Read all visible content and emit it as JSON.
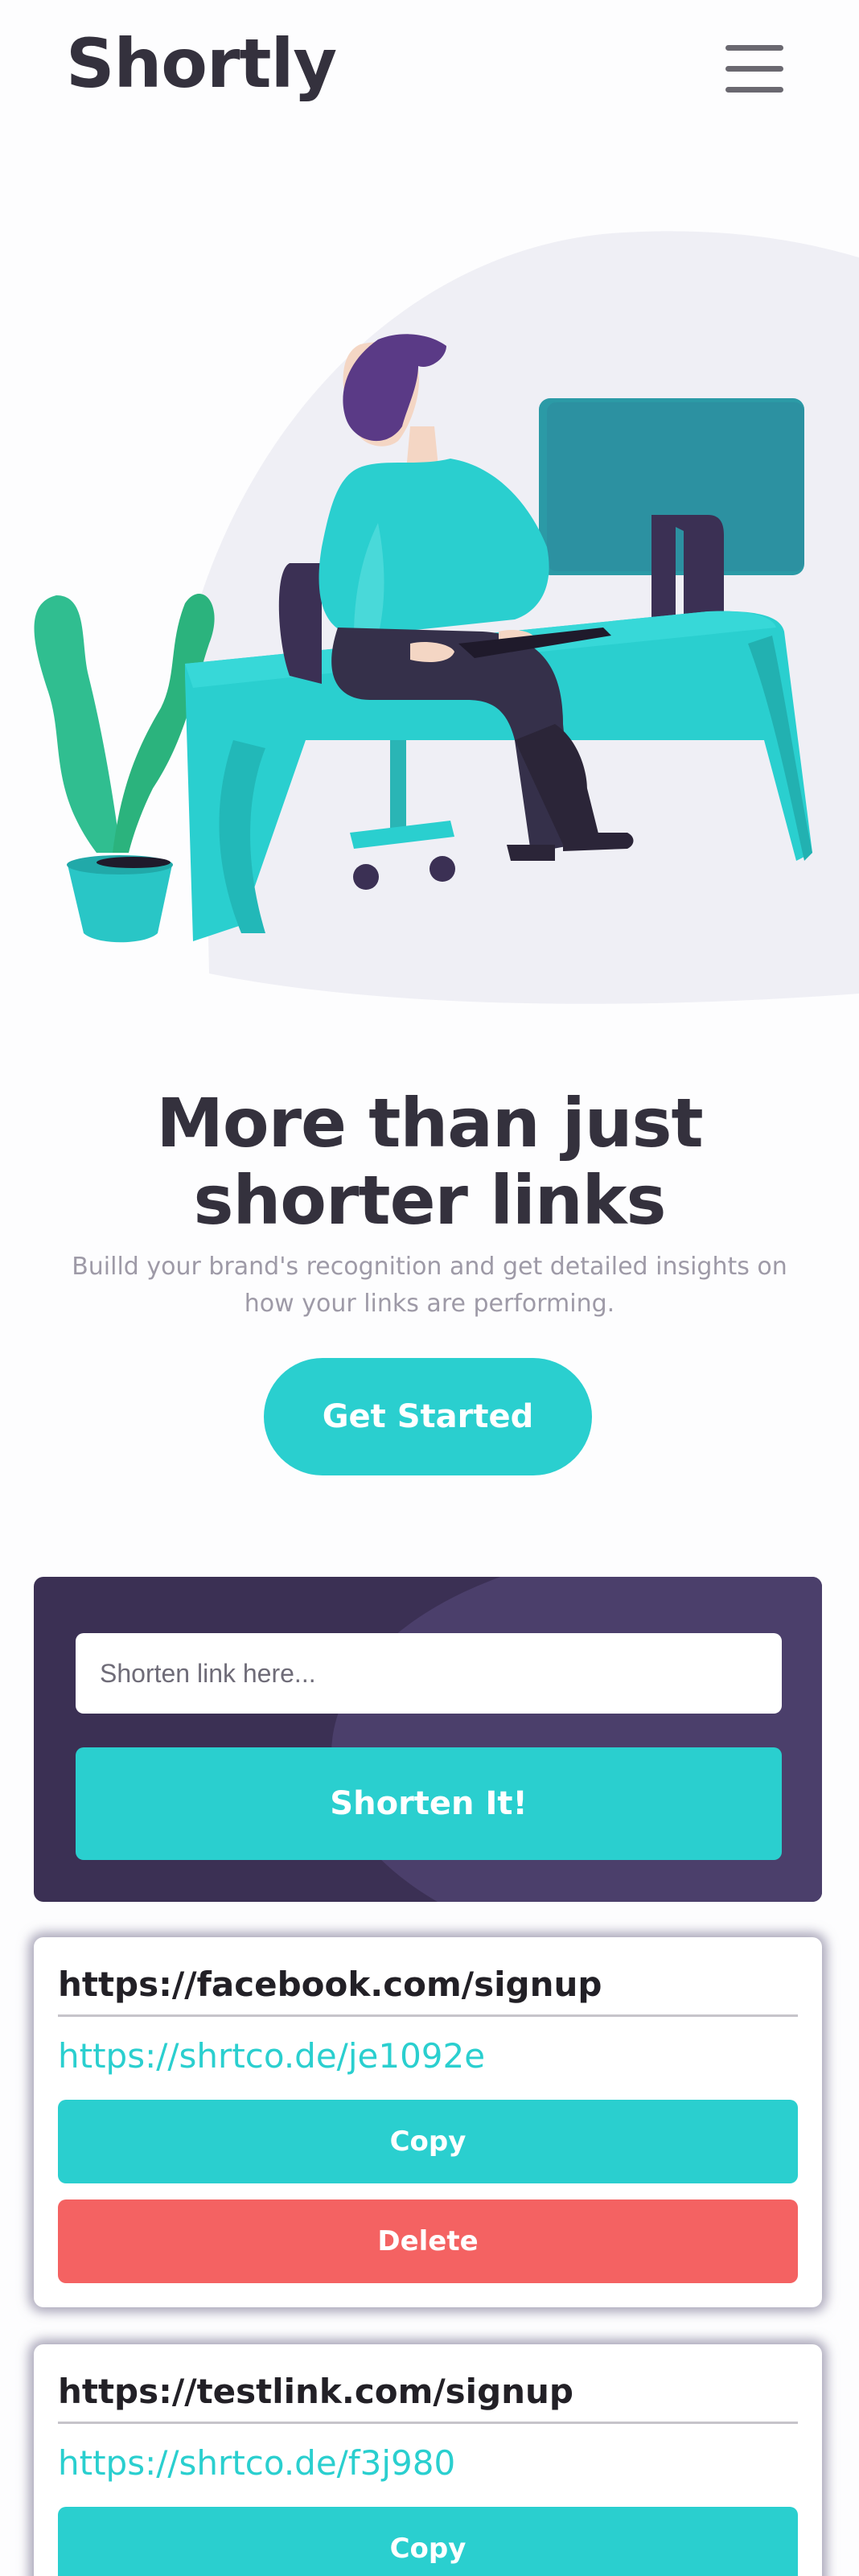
{
  "header": {
    "logo": "Shortly",
    "menu_icon": "hamburger-menu-icon"
  },
  "hero": {
    "illustration": "person-working-at-desk-illustration",
    "title": "More than just shorter links",
    "subtitle": "Builld your brand's recognition and get detailed insights on how your links are performing.",
    "cta_label": "Get Started"
  },
  "shorten": {
    "placeholder": "Shorten link here...",
    "value": "",
    "button_label": "Shorten It!"
  },
  "results": [
    {
      "original": "https://facebook.com/signup",
      "short": "https://shrtco.de/je1092e",
      "copy_label": "Copy",
      "delete_label": "Delete"
    },
    {
      "original": "https://testlink.com/signup",
      "short": "https://shrtco.de/f3j980",
      "copy_label": "Copy"
    }
  ],
  "colors": {
    "primary": "#2acfcf",
    "dark_violet": "#3b3054",
    "red": "#f46262",
    "text_dark": "#34313d",
    "text_gray": "#9e9aa7"
  }
}
